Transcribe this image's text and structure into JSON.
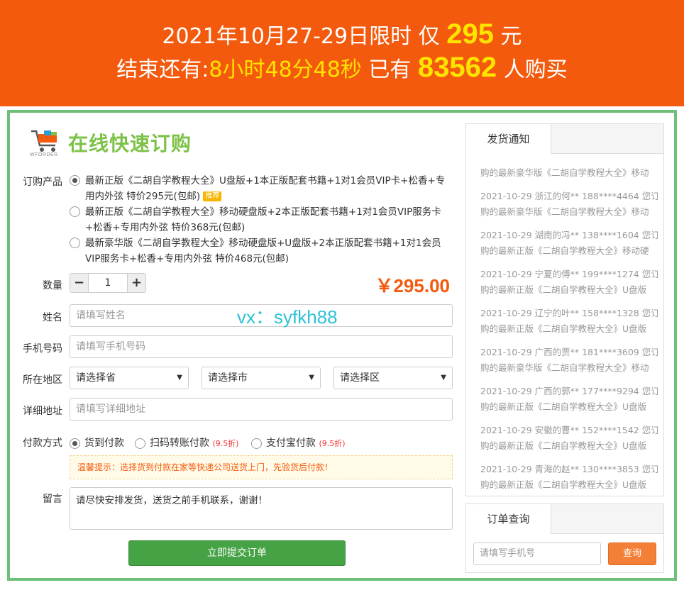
{
  "banner": {
    "line1_prefix": "2021年10月27-29日限时 仅",
    "price": "295",
    "line1_suffix": "元",
    "countdown_label": "结束还有:",
    "countdown": "8小时48分48秒",
    "buyers_prefix": "已有",
    "buyers": "83562",
    "buyers_suffix": "人购买"
  },
  "brand": {
    "logo_caption": "WFORDER",
    "title": "在线快速订购"
  },
  "form": {
    "product_label": "订购产品",
    "products": [
      {
        "line1": "最新正版《二胡自学教程大全》U盘版+1本正版配套书籍+1对1会员VIP卡+松香+专",
        "line2": "用内外弦 特价295元(包邮)",
        "tag": "推荐",
        "selected": true
      },
      {
        "line1": "最新正版《二胡自学教程大全》移动硬盘版+2本正版配套书籍+1对1会员VIP服务卡",
        "line2": "+松香+专用内外弦 特价368元(包邮)",
        "selected": false
      },
      {
        "line1": "最新豪华版《二胡自学教程大全》移动硬盘版+U盘版+2本正版配套书籍+1对1会员",
        "line2": "VIP服务卡+松香+专用内外弦 特价468元(包邮)",
        "selected": false
      }
    ],
    "qty_label": "数量",
    "qty_minus": "−",
    "qty_value": "1",
    "qty_plus": "+",
    "total": "￥295.00",
    "name_label": "姓名",
    "name_placeholder": "请填写姓名",
    "overlay_text": "vx：syfkh88",
    "phone_label": "手机号码",
    "phone_placeholder": "请填写手机号码",
    "region_label": "所在地区",
    "province": "请选择省",
    "city": "请选择市",
    "district": "请选择区",
    "address_label": "详细地址",
    "address_placeholder": "请填写详细地址",
    "payment_label": "付款方式",
    "payments": [
      {
        "label": "货到付款",
        "discount": "",
        "selected": true
      },
      {
        "label": "扫码转账付款",
        "discount": "(9.5折)",
        "selected": false
      },
      {
        "label": "支付宝付款",
        "discount": "(9.5折)",
        "selected": false
      }
    ],
    "tip": "温馨提示：选择货到付款在家等快递公司送货上门，先验货后付款！",
    "message_label": "留言",
    "message_value": "请尽快安排发货，送货之前手机联系，谢谢！",
    "submit": "立即提交订单"
  },
  "shipping": {
    "tab": "发货通知",
    "first_line": "购的最新豪华版《二胡自学教程大全》移动",
    "entries": [
      {
        "head": "2021-10-29 浙江的何** 188****4464 您订",
        "body": "购的最新豪华版《二胡自学教程大全》移动"
      },
      {
        "head": "2021-10-29 湖南的冯** 138****1604 您订",
        "body": "购的最新正版《二胡自学教程大全》移动硬"
      },
      {
        "head": "2021-10-29 宁夏的傅** 199****1274 您订",
        "body": "购的最新正版《二胡自学教程大全》U盘版"
      },
      {
        "head": "2021-10-29 辽宁的叶** 158****1328 您订",
        "body": "购的最新正版《二胡自学教程大全》U盘版"
      },
      {
        "head": "2021-10-29 广西的贾** 181****3609 您订",
        "body": "购的最新豪华版《二胡自学教程大全》移动"
      },
      {
        "head": "2021-10-29 广西的郭** 177****9294 您订",
        "body": "购的最新正版《二胡自学教程大全》U盘版"
      },
      {
        "head": "2021-10-29 安徽的曹** 152****1542 您订",
        "body": "购的最新正版《二胡自学教程大全》U盘版"
      },
      {
        "head": "2021-10-29 青海的赵** 130****3853 您订",
        "body": "购的最新正版《二胡自学教程大全》U盘版"
      }
    ]
  },
  "query": {
    "tab": "订单查询",
    "placeholder": "请填写手机号",
    "button": "查询"
  },
  "colors": {
    "banner": "#f45a0d",
    "highlight": "#ffe400",
    "frame": "#6dbf7a",
    "submit": "#45a245",
    "query_button": "#f47f36"
  }
}
